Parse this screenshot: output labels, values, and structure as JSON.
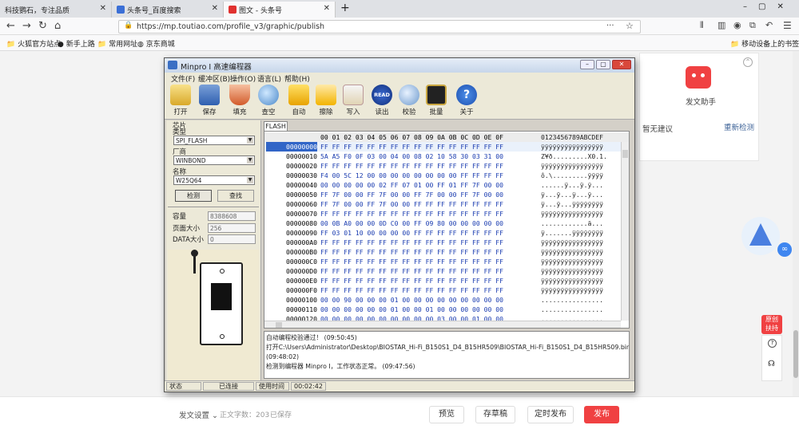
{
  "browser": {
    "tabs": [
      {
        "title": "科技鹦石，专注品质"
      },
      {
        "title": "头条号_百度搜索"
      },
      {
        "title": "图文 - 头条号"
      }
    ],
    "new_tab": "+",
    "url": "https://mp.toutiao.com/profile_v3/graphic/publish",
    "bookmarks": [
      "火狐官方站点",
      "新手上路",
      "常用网址",
      "京东商城"
    ],
    "mobile_bookmarks": "移动设备上的书签"
  },
  "right_panel": {
    "assistant": "发文助手",
    "no_suggestion": "暂无建议",
    "recheck": "重新检测",
    "side_buttons": [
      "原创",
      "扶持"
    ]
  },
  "bottom": {
    "settings": "发文设置",
    "word_count": "正文字数：203",
    "saved": "已保存",
    "preview": "预览",
    "draft": "存草稿",
    "schedule": "定时发布",
    "publish": "发布"
  },
  "programmer": {
    "title": "Minpro I 高速编程器",
    "menu": [
      "文件(F)",
      "缓冲区(B)",
      "操作(O)",
      "语言(L)",
      "帮助(H)"
    ],
    "toolbar": [
      "打开",
      "保存",
      "填充",
      "查空",
      "自动",
      "擦除",
      "写入",
      "读出",
      "校验",
      "批量",
      "关于"
    ],
    "read_badge": "READ",
    "chip_label": "芯片",
    "type_label": "类型",
    "type_value": "SPI_FLASH",
    "maker_label": "厂商",
    "maker_value": "WINBOND",
    "name_label": "名称",
    "name_value": "W25Q64",
    "detect": "检测",
    "find": "查找",
    "capacity_label": "容量",
    "capacity_value": "8388608",
    "page_label": "页面大小",
    "page_value": "256",
    "data_label": "DATA大小",
    "data_value": "0",
    "flash_tab": "FLASH",
    "hex_header": "00 01 02 03 04 05 06 07 08 09 0A 0B 0C 0D 0E 0F",
    "ascii_header": "0123456789ABCDEF",
    "rows": [
      {
        "addr": "00000000",
        "bytes": "FF FF FF FF FF FF FF FF FF FF FF FF FF FF FF FF",
        "ascii": "ÿÿÿÿÿÿÿÿÿÿÿÿÿÿÿÿ"
      },
      {
        "addr": "00000010",
        "bytes": "5A A5 F0 0F 03 00 04 00 08 02 10 58 30 03 31 00",
        "ascii": "Z¥ð.........X0.1."
      },
      {
        "addr": "00000020",
        "bytes": "FF FF FF FF FF FF FF FF FF FF FF FF FF FF FF FF",
        "ascii": "ÿÿÿÿÿÿÿÿÿÿÿÿÿÿÿÿ"
      },
      {
        "addr": "00000030",
        "bytes": "F4 00 5C 12 00 00 00 00 00 00 00 00 FF FF FF FF",
        "ascii": "ô.\\.........ÿÿÿÿ"
      },
      {
        "addr": "00000040",
        "bytes": "00 00 00 00 00 02 FF 07 01 00 FF 01 FF 7F 00 00",
        "ascii": "......ÿ...ÿ.ÿ..."
      },
      {
        "addr": "00000050",
        "bytes": "FF 7F 00 00 FF 7F 00 00 FF 7F 00 00 FF 7F 00 00",
        "ascii": "ÿ...ÿ...ÿ...ÿ..."
      },
      {
        "addr": "00000060",
        "bytes": "FF 7F 00 00 FF 7F 00 00 FF FF FF FF FF FF FF FF",
        "ascii": "ÿ...ÿ...ÿÿÿÿÿÿÿÿ"
      },
      {
        "addr": "00000070",
        "bytes": "FF FF FF FF FF FF FF FF FF FF FF FF FF FF FF FF",
        "ascii": "ÿÿÿÿÿÿÿÿÿÿÿÿÿÿÿÿ"
      },
      {
        "addr": "00000080",
        "bytes": "00 0B A0 00 00 0D C0 00 FF 09 80 00 00 00 00 00",
        "ascii": "............ä..."
      },
      {
        "addr": "00000090",
        "bytes": "FF 03 01 10 00 00 00 00 FF FF FF FF FF FF FF FF",
        "ascii": "ÿ.......ÿÿÿÿÿÿÿÿ"
      },
      {
        "addr": "000000A0",
        "bytes": "FF FF FF FF FF FF FF FF FF FF FF FF FF FF FF FF",
        "ascii": "ÿÿÿÿÿÿÿÿÿÿÿÿÿÿÿÿ"
      },
      {
        "addr": "000000B0",
        "bytes": "FF FF FF FF FF FF FF FF FF FF FF FF FF FF FF FF",
        "ascii": "ÿÿÿÿÿÿÿÿÿÿÿÿÿÿÿÿ"
      },
      {
        "addr": "000000C0",
        "bytes": "FF FF FF FF FF FF FF FF FF FF FF FF FF FF FF FF",
        "ascii": "ÿÿÿÿÿÿÿÿÿÿÿÿÿÿÿÿ"
      },
      {
        "addr": "000000D0",
        "bytes": "FF FF FF FF FF FF FF FF FF FF FF FF FF FF FF FF",
        "ascii": "ÿÿÿÿÿÿÿÿÿÿÿÿÿÿÿÿ"
      },
      {
        "addr": "000000E0",
        "bytes": "FF FF FF FF FF FF FF FF FF FF FF FF FF FF FF FF",
        "ascii": "ÿÿÿÿÿÿÿÿÿÿÿÿÿÿÿÿ"
      },
      {
        "addr": "000000F0",
        "bytes": "FF FF FF FF FF FF FF FF FF FF FF FF FF FF FF FF",
        "ascii": "ÿÿÿÿÿÿÿÿÿÿÿÿÿÿÿÿ"
      },
      {
        "addr": "00000100",
        "bytes": "00 00 90 00 00 00 01 00 00 00 00 00 00 00 00 00",
        "ascii": "................"
      },
      {
        "addr": "00000110",
        "bytes": "00 00 00 00 00 00 01 00 00 01 00 00 00 00 00 00",
        "ascii": "................"
      },
      {
        "addr": "00000120",
        "bytes": "00 00 00 00 00 00 00 00 00 00 03 00 00 01 00 00",
        "ascii": "................"
      }
    ],
    "log": [
      "自动编程校验通过！ (09:50:45)",
      "打开C:\\Users\\Administrator\\Desktop\\BIOSTAR_Hi-Fi_B150S1_D4_B15HR509\\BIOSTAR_Hi-Fi_B150S1_D4_B15HR509.bin",
      "(09:48:02)",
      "检测到编程器 Minpro I，工作状态正常。 (09:47:56)"
    ],
    "status": [
      "状态",
      "已连接",
      "使用时间",
      "00:02:42"
    ]
  }
}
